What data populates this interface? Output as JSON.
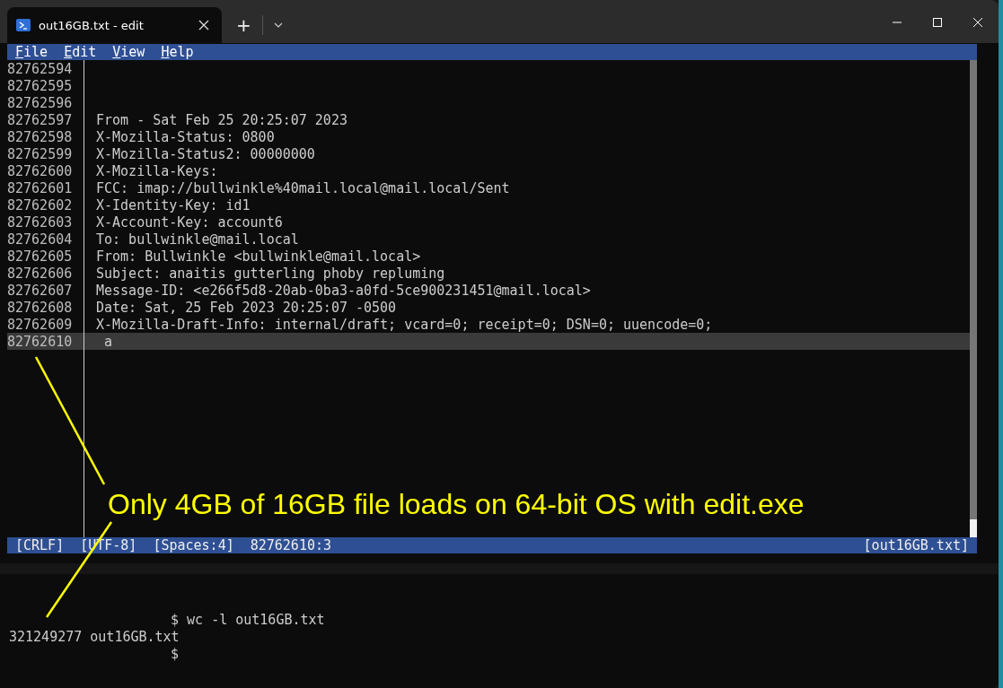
{
  "window": {
    "tab_title": "out16GB.txt - edit",
    "new_tab": "+"
  },
  "menu": [
    {
      "label": "File"
    },
    {
      "label": "Edit"
    },
    {
      "label": "View"
    },
    {
      "label": "Help"
    }
  ],
  "lines": [
    {
      "number": "82762594",
      "current": false
    },
    {
      "number": "82762595",
      "current": false
    },
    {
      "number": "82762596",
      "current": false
    },
    {
      "number": "82762597",
      "text": "From - Sat Feb 25 20:25:07 2023",
      "current": false
    },
    {
      "number": "82762598",
      "text": "X-Mozilla-Status: 0800",
      "current": false
    },
    {
      "number": "82762599",
      "text": "X-Mozilla-Status2: 00000000",
      "current": false
    },
    {
      "number": "82762600",
      "text": "X-Mozilla-Keys:",
      "current": false
    },
    {
      "number": "82762601",
      "text": "FCC: imap://bullwinkle%40mail.local@mail.local/Sent",
      "current": false
    },
    {
      "number": "82762602",
      "text": "X-Identity-Key: id1",
      "current": false
    },
    {
      "number": "82762603",
      "text": "X-Account-Key: account6",
      "current": false
    },
    {
      "number": "82762604",
      "text": "To: bullwinkle@mail.local",
      "current": false
    },
    {
      "number": "82762605",
      "text": "From: Bullwinkle <bullwinkle@mail.local>",
      "current": false
    },
    {
      "number": "82762606",
      "text": "Subject: anaitis gutterling phoby repluming",
      "current": false
    },
    {
      "number": "82762607",
      "text": "Message-ID: <e266f5d8-20ab-0ba3-a0fd-5ce900231451@mail.local>",
      "current": false
    },
    {
      "number": "82762608",
      "text": "Date: Sat, 25 Feb 2023 20:25:07 -0500",
      "current": false
    },
    {
      "number": "82762609",
      "text": "X-Mozilla-Draft-Info: internal/draft; vcard=0; receipt=0; DSN=0; uuencode=0;",
      "current": false
    },
    {
      "number": "82762610",
      "text": " a",
      "current": true
    }
  ],
  "status_bar": {
    "items": [
      "[CRLF]",
      "[UTF-8]",
      "[Spaces:4]",
      "82762610:3"
    ],
    "file": "[out16GB.txt]"
  },
  "annotation": {
    "text": "Only 4GB of 16GB file loads on 64-bit OS with edit.exe"
  },
  "terminal": [
    {
      "kind": "prompt",
      "text": "$ wc -l out16GB.txt"
    },
    {
      "kind": "output",
      "text": "321249277 out16GB.txt"
    },
    {
      "kind": "prompt",
      "text": "$"
    }
  ]
}
